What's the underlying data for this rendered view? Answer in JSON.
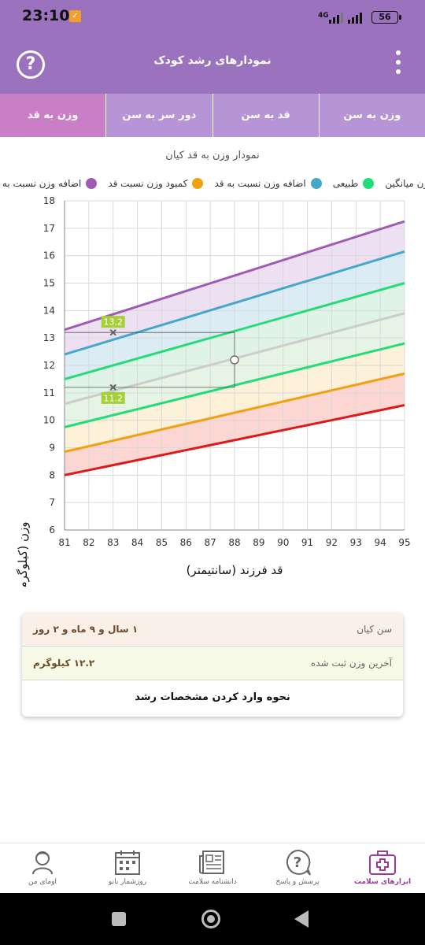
{
  "status": {
    "time": "23:10",
    "network": "4G",
    "battery": "56"
  },
  "app_bar": {
    "title": "نمودارهای رشد کودک",
    "help": "?"
  },
  "tabs": [
    {
      "label": "وزن به قد",
      "active": true
    },
    {
      "label": "دور سر به سن",
      "active": false
    },
    {
      "label": "قد به سن",
      "active": false
    },
    {
      "label": "وزن به سن",
      "active": false
    }
  ],
  "chart_title": "نمودار وزن به قد کیان",
  "legend": [
    {
      "label": "اضافه وزن نسبت به قد",
      "color": "#a05bb5"
    },
    {
      "label": "کمبود وزن نسبت قد",
      "color": "#f0a010"
    },
    {
      "label": "اضافه وزن نسبت به قد",
      "color": "#44a8c8"
    },
    {
      "label": "طبیعی",
      "color": "#22dd77"
    },
    {
      "label": "وزن میانگین",
      "color": "#cccccc"
    }
  ],
  "chart_data": {
    "type": "line",
    "xlabel": "قد فرزند (سانتیمتر)",
    "ylabel": "وزن (کیلوگرم)",
    "xlim": [
      81,
      95
    ],
    "ylim": [
      6,
      18
    ],
    "x_ticks": [
      "81",
      "82",
      "83",
      "84",
      "85",
      "86",
      "87",
      "88",
      "89",
      "90",
      "91",
      "92",
      "93",
      "94",
      "95"
    ],
    "y_ticks": [
      "6",
      "7",
      "8",
      "9",
      "10",
      "11",
      "12",
      "13",
      "14",
      "15",
      "16",
      "17",
      "18"
    ],
    "grid": true,
    "series": [
      {
        "color": "#a05bb5",
        "fill": "#ede0f3",
        "x": [
          81,
          95
        ],
        "y": [
          13.3,
          17.25
        ]
      },
      {
        "color": "#44a8c8",
        "fill": "#dcecf5",
        "x": [
          81,
          95
        ],
        "y": [
          12.4,
          16.15
        ]
      },
      {
        "color": "#22dd77",
        "fill": "#dff3e6",
        "x": [
          81,
          95
        ],
        "y": [
          11.5,
          15.0
        ]
      },
      {
        "color": "#cccccc",
        "fill": "#e6f4e6",
        "x": [
          81,
          95
        ],
        "y": [
          10.6,
          13.9
        ]
      },
      {
        "color": "#22dd77",
        "fill": "#fdf1d9",
        "x": [
          81,
          95
        ],
        "y": [
          9.75,
          12.8
        ]
      },
      {
        "color": "#f0a010",
        "fill": "#fbd6d3",
        "x": [
          81,
          95
        ],
        "y": [
          8.85,
          11.7
        ]
      },
      {
        "color": "#e01818",
        "fill": null,
        "x": [
          81,
          95
        ],
        "y": [
          8.0,
          10.55
        ]
      }
    ],
    "markers": [
      {
        "x": 83,
        "y": 13.2,
        "label": "13.2"
      },
      {
        "x": 83,
        "y": 11.2,
        "label": "11.2"
      }
    ],
    "point": {
      "x": 88,
      "y": 12.2
    }
  },
  "info": {
    "age_label": "سن کیان",
    "age_value": "۱ سال و ۹ ماه و ۲ روز",
    "weight_label": "آخرین وزن ثبت شده",
    "weight_value": "۱۲.۲ کیلوگرم",
    "link": "نحوه وارد کردن مشخصات رشد"
  },
  "bottom_nav": [
    {
      "label": "اومای من",
      "icon": "profile-icon",
      "active": false
    },
    {
      "label": "روزشمار بانو",
      "icon": "calendar-icon",
      "active": false
    },
    {
      "label": "دانشنامه سلامت",
      "icon": "newspaper-icon",
      "active": false
    },
    {
      "label": "پرسش و پاسخ",
      "icon": "question-bubble-icon",
      "active": false
    },
    {
      "label": "ابزارهای سلامت",
      "icon": "medical-kit-icon",
      "active": true
    }
  ]
}
